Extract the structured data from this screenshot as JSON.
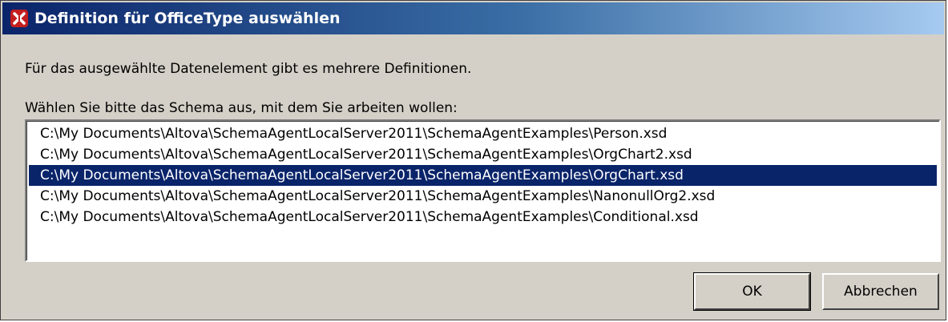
{
  "window": {
    "title": "Definition für OfficeType auswählen"
  },
  "dialog": {
    "message": "Für das ausgewählte Datenelement gibt es mehrere Definitionen.",
    "prompt": "Wählen Sie bitte das Schema aus, mit dem Sie arbeiten wollen:",
    "schemas": [
      "C:\\My Documents\\Altova\\SchemaAgentLocalServer2011\\SchemaAgentExamples\\Person.xsd",
      "C:\\My Documents\\Altova\\SchemaAgentLocalServer2011\\SchemaAgentExamples\\OrgChart2.xsd",
      "C:\\My Documents\\Altova\\SchemaAgentLocalServer2011\\SchemaAgentExamples\\OrgChart.xsd",
      "C:\\My Documents\\Altova\\SchemaAgentLocalServer2011\\SchemaAgentExamples\\NanonullOrg2.xsd",
      "C:\\My Documents\\Altova\\SchemaAgentLocalServer2011\\SchemaAgentExamples\\Conditional.xsd"
    ],
    "selected_index": 2
  },
  "buttons": {
    "ok_label": "OK",
    "cancel_label": "Abbrechen"
  },
  "colors": {
    "titlebar_start": "#0a246a",
    "titlebar_end": "#a6caf0",
    "selection": "#0a246a",
    "dialog_face": "#d4d0c8"
  },
  "icons": {
    "title_icon": "altova-logo-icon"
  }
}
